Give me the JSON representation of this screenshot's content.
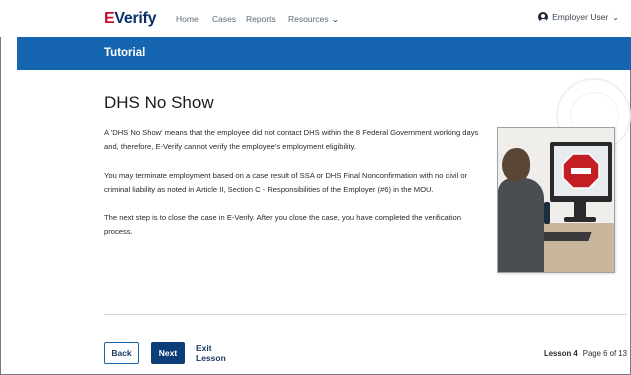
{
  "header": {
    "logo_e": "E",
    "logo_verify": "Verify",
    "nav": [
      "Home",
      "Cases",
      "Reports",
      "Resources"
    ],
    "user_label": "Employer User"
  },
  "banner": {
    "title": "Tutorial"
  },
  "content": {
    "heading": "DHS No Show",
    "paragraphs": [
      "A 'DHS No Show' means that the employee did not contact DHS within the 8 Federal Government working days and, therefore, E-Verify cannot verify the employee's employment eligibility.",
      "You may terminate employment based on a case result of SSA or DHS Final Nonconfirmation with no civil or criminal liability as noted in Article II, Section C - Responsibilities of the Employer (#6) in the MOU.",
      "The next step is to close the case in E-Verify. After you close the case, you have completed the verification process."
    ]
  },
  "footer": {
    "back_label": "Back",
    "next_label": "Next",
    "exit_label": "Exit Lesson",
    "lesson_label": "Lesson 4",
    "page_label": "Page 6 of 13"
  },
  "colors": {
    "banner": "#1565b0",
    "next_button": "#0b3d77",
    "logo_red": "#c8102e",
    "logo_navy": "#0a2f6b",
    "stop_sign": "#c41e24"
  },
  "icons": {
    "user": "user-circle-icon",
    "dropdown": "chevron-down-icon",
    "illustration_sign": "stop-sign-icon"
  }
}
